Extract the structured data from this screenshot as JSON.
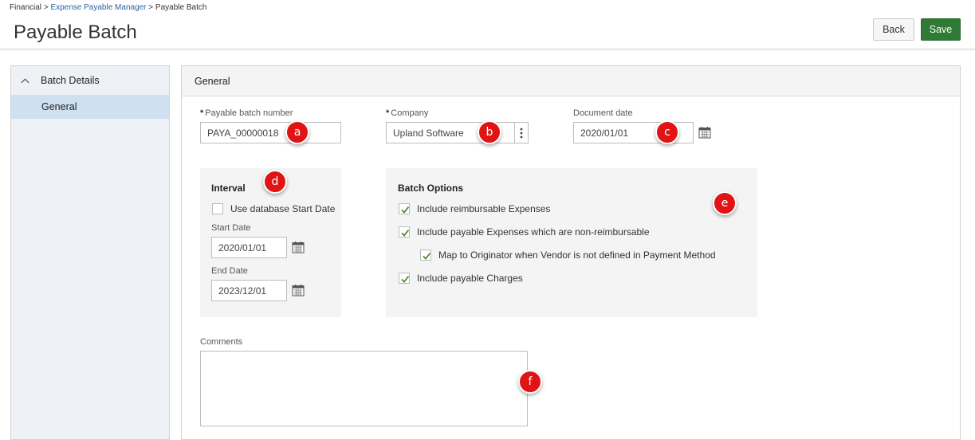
{
  "breadcrumb": {
    "root": "Financial",
    "sep1": ">",
    "parent": "Expense Payable Manager",
    "sep2": ">",
    "current": "Payable Batch"
  },
  "page": {
    "title": "Payable Batch"
  },
  "toolbar": {
    "back_label": "Back",
    "save_label": "Save",
    "save_color": "#2f7a34"
  },
  "sidebar": {
    "section_label": "Batch Details",
    "items": [
      {
        "label": "General",
        "selected": true
      }
    ]
  },
  "panel": {
    "title": "General"
  },
  "fields": {
    "batch_number": {
      "required_mark": "*",
      "label": "Payable batch number",
      "value": "PAYA_00000018"
    },
    "company": {
      "required_mark": "*",
      "label": "Company",
      "value": "Upland Software"
    },
    "document_date": {
      "label": "Document date",
      "value": "2020/01/01"
    }
  },
  "interval": {
    "title": "Interval",
    "use_db_start": {
      "label": "Use database Start Date",
      "checked": false
    },
    "start_date": {
      "label": "Start Date",
      "value": "2020/01/01"
    },
    "end_date": {
      "label": "End Date",
      "value": "2023/12/01"
    }
  },
  "batch_options": {
    "title": "Batch Options",
    "options": [
      {
        "label": "Include reimbursable Expenses",
        "checked": true
      },
      {
        "label": "Include payable Expenses which are non-reimbursable",
        "checked": true
      },
      {
        "label": "Map to Originator when Vendor is not defined in Payment Method",
        "checked": true
      },
      {
        "label": "Include payable Charges",
        "checked": true
      }
    ]
  },
  "comments": {
    "label": "Comments",
    "value": ""
  },
  "callouts": {
    "a": "a",
    "b": "b",
    "c": "c",
    "d": "d",
    "e": "e",
    "f": "f"
  }
}
